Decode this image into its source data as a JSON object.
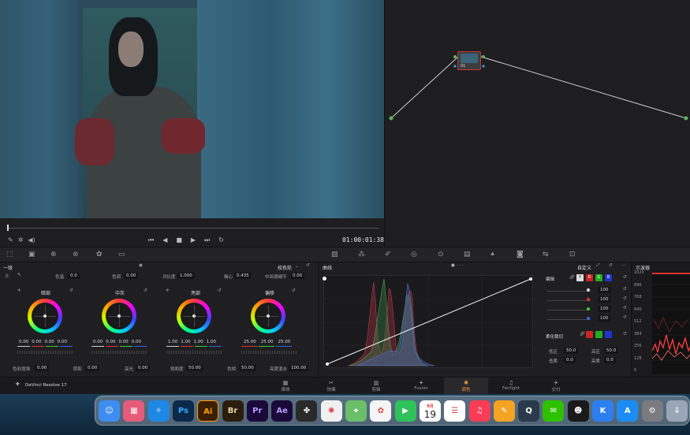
{
  "viewer": {
    "timecode": "01:00:01:38",
    "transport_icons": [
      "prev-icon",
      "step-back-icon",
      "stop-icon",
      "play-icon",
      "next-icon",
      "loop-icon"
    ]
  },
  "nodes": {
    "node_label": "01"
  },
  "primaries": {
    "title": "一级",
    "mode": "校色轮",
    "top_controls": [
      {
        "label": "色温",
        "value": "0.0"
      },
      {
        "label": "色调",
        "value": "0.00"
      },
      {
        "label": "对比度",
        "value": "1.000"
      },
      {
        "label": "轴心",
        "value": "0.435"
      },
      {
        "label": "中间调细节",
        "value": "0.00"
      }
    ],
    "wheels": [
      {
        "name": "暗部",
        "values": [
          "0.00",
          "0.00",
          "0.00",
          "0.00"
        ]
      },
      {
        "name": "中灰",
        "values": [
          "0.00",
          "0.00",
          "0.00",
          "0.00"
        ]
      },
      {
        "name": "亮部",
        "values": [
          "1.00",
          "1.00",
          "1.00",
          "1.00"
        ]
      },
      {
        "name": "偏移",
        "values": [
          "25.00",
          "25.00",
          "25.00"
        ]
      }
    ],
    "bottom_controls": [
      {
        "label": "色彩增强",
        "value": "0.00"
      },
      {
        "label": "阴影",
        "value": "0.00"
      },
      {
        "label": "高光",
        "value": "0.00"
      },
      {
        "label": "饱和度",
        "value": "50.00"
      },
      {
        "label": "色相",
        "value": "50.00"
      },
      {
        "label": "亮度混合",
        "value": "100.00"
      }
    ]
  },
  "curves": {
    "title": "曲线",
    "mode": "自定义",
    "edit_label": "编辑",
    "channel_chips": [
      "Y",
      "R",
      "G",
      "B"
    ],
    "channel_values": [
      "100",
      "100",
      "100",
      "100"
    ],
    "soft_clip_label": "柔化裁切",
    "soft_clip": [
      {
        "label": "低区",
        "value": "50.0"
      },
      {
        "label": "高区",
        "value": "50.0"
      },
      {
        "label": "低柔",
        "value": "0.0"
      },
      {
        "label": "高柔",
        "value": "0.0"
      }
    ]
  },
  "scope": {
    "title": "示波器",
    "ticks": [
      "1023",
      "896",
      "768",
      "640",
      "512",
      "384",
      "256",
      "128",
      "0"
    ]
  },
  "pages": {
    "app_name": "DaVinci Resolve 17",
    "tabs": [
      "媒体",
      "快编",
      "剪辑",
      "Fusion",
      "调色",
      "Fairlight",
      "交付"
    ],
    "active": "调色"
  },
  "dock": {
    "apps": [
      {
        "name": "Finder",
        "label": "",
        "color": "#3d8ef0"
      },
      {
        "name": "Launchpad",
        "label": "",
        "color": "#e65a7a"
      },
      {
        "name": "Safari",
        "label": "",
        "color": "#1e88e5"
      },
      {
        "name": "Photoshop",
        "label": "Ps",
        "color": "#0b2a4a"
      },
      {
        "name": "Illustrator",
        "label": "Ai",
        "color": "#3a1f00"
      },
      {
        "name": "Bridge",
        "label": "Br",
        "color": "#2b1d0e"
      },
      {
        "name": "Premiere Pro",
        "label": "Pr",
        "color": "#1a0a3a"
      },
      {
        "name": "After Effects",
        "label": "Ae",
        "color": "#1a0a3a"
      },
      {
        "name": "DaVinci Resolve",
        "label": "",
        "color": "#2a2a2a"
      },
      {
        "name": "Pinwheel",
        "label": "",
        "color": "#f0f0f0"
      },
      {
        "name": "Maps",
        "label": "",
        "color": "#6abf69"
      },
      {
        "name": "Photos",
        "label": "",
        "color": "#f5f5f5"
      },
      {
        "name": "FaceTime",
        "label": "",
        "color": "#2fc15a"
      },
      {
        "name": "Calendar",
        "label": "19",
        "month": "9月",
        "color": "#ffffff"
      },
      {
        "name": "Reminders",
        "label": "",
        "color": "#ffffff"
      },
      {
        "name": "Music",
        "label": "",
        "color": "#fa3c55"
      },
      {
        "name": "Pages",
        "label": "",
        "color": "#f4a323"
      },
      {
        "name": "QuickTime",
        "label": "",
        "color": "#2a3a4a"
      },
      {
        "name": "WeChat",
        "label": "",
        "color": "#2dc100"
      },
      {
        "name": "QQ",
        "label": "",
        "color": "#1a1a1a"
      },
      {
        "name": "Klokki",
        "label": "K",
        "color": "#2d7ff0"
      },
      {
        "name": "App Store",
        "label": "",
        "color": "#1c8cf2"
      },
      {
        "name": "System Preferences",
        "label": "",
        "color": "#7b7b80"
      },
      {
        "name": "Downloads",
        "label": "",
        "color": "#9aa6b5"
      }
    ]
  }
}
